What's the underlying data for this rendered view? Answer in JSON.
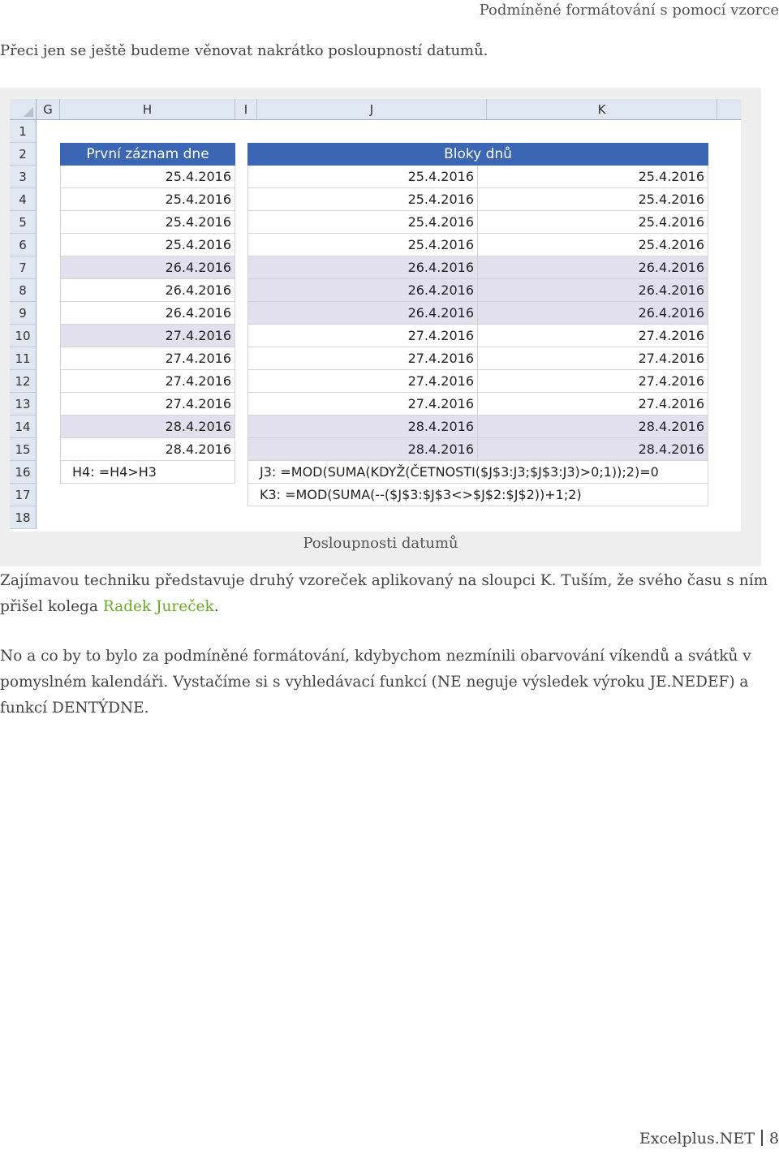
{
  "running_head": "Podmíněné formátování s pomocí vzorce",
  "intro": "Přeci jen se ještě budeme věnovat nakrátko posloupností datumů.",
  "sheet": {
    "columns": [
      "G",
      "H",
      "I",
      "J",
      "K"
    ],
    "rows": [
      "1",
      "2",
      "3",
      "4",
      "5",
      "6",
      "7",
      "8",
      "9",
      "10",
      "11",
      "12",
      "13",
      "14",
      "15",
      "16",
      "17",
      "18"
    ],
    "h_header": "První záznam dne",
    "jk_header": "Bloky dnů",
    "data": [
      {
        "date": "25.4.2016",
        "h_band": false,
        "jk_band": false
      },
      {
        "date": "25.4.2016",
        "h_band": false,
        "jk_band": false
      },
      {
        "date": "25.4.2016",
        "h_band": false,
        "jk_band": false
      },
      {
        "date": "25.4.2016",
        "h_band": false,
        "jk_band": false
      },
      {
        "date": "26.4.2016",
        "h_band": true,
        "jk_band": true
      },
      {
        "date": "26.4.2016",
        "h_band": false,
        "jk_band": true
      },
      {
        "date": "26.4.2016",
        "h_band": false,
        "jk_band": true
      },
      {
        "date": "27.4.2016",
        "h_band": true,
        "jk_band": false
      },
      {
        "date": "27.4.2016",
        "h_band": false,
        "jk_band": false
      },
      {
        "date": "27.4.2016",
        "h_band": false,
        "jk_band": false
      },
      {
        "date": "27.4.2016",
        "h_band": false,
        "jk_band": false
      },
      {
        "date": "28.4.2016",
        "h_band": true,
        "jk_band": true
      },
      {
        "date": "28.4.2016",
        "h_band": false,
        "jk_band": true
      }
    ],
    "formula_h": "H4: =H4>H3",
    "formula_j": "J3: =MOD(SUMA(KDYŽ(ČETNOSTI($J$3:J3;$J$3:J3)>0;1));2)=0",
    "formula_k": "K3: =MOD(SUMA(--($J$3:$J$3<>$J$2:$J$2))+1;2)",
    "colors": {
      "header_fill": "#3a66b3",
      "band_fill": "#e3e0ee",
      "col_header_fill": "#dfe7f1"
    }
  },
  "caption": "Posloupnosti datumů",
  "para1": {
    "text": "Zajímavou techniku představuje druhý vzoreček aplikovaný na sloupci K. Tuším, že svého času s ním přišel kolega ",
    "link": "Radek Jureček",
    "end": "."
  },
  "para2": "No a co by to bylo za podmíněné formátování, kdybychom nezmínili obarvování víkendů a svátků v pomyslném kalendáři. Vystačíme si s vyhledávací funkcí (NE neguje výsledek výroku JE.NEDEF) a funkcí DENTÝDNE.",
  "footer": {
    "site": "Excelplus.NET",
    "page": "8"
  }
}
